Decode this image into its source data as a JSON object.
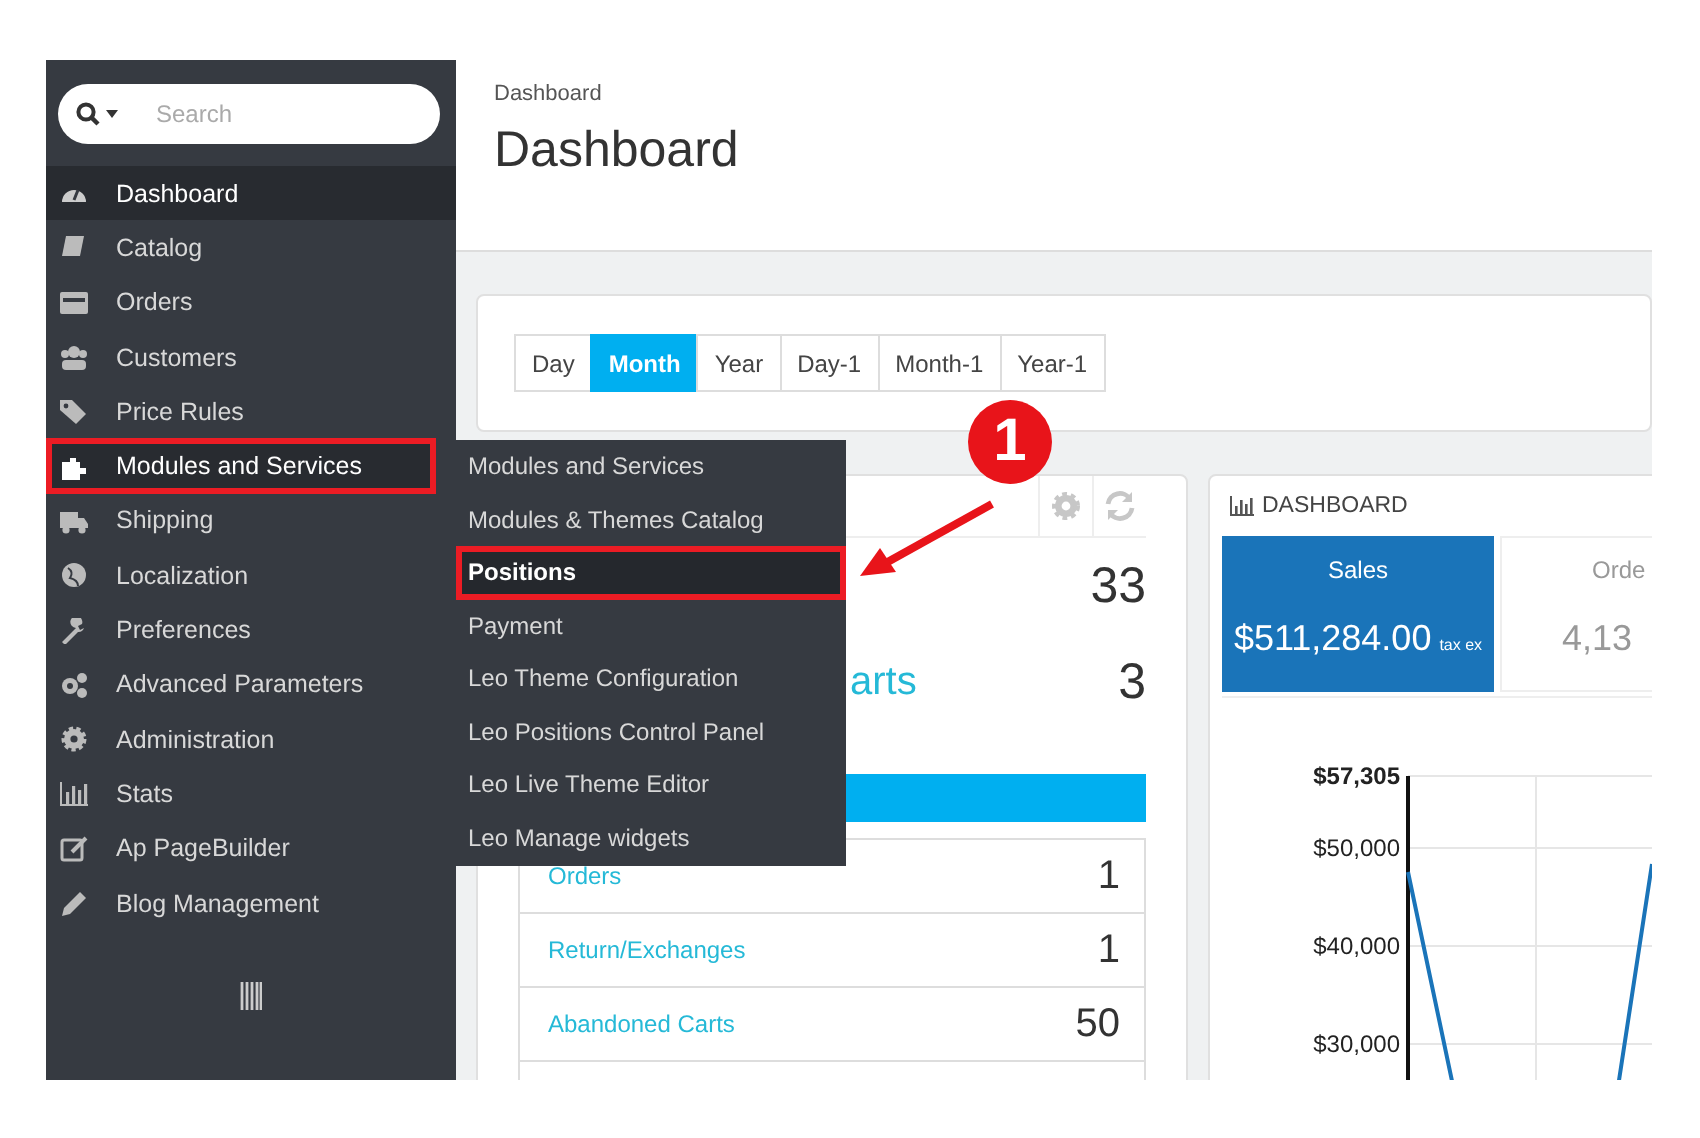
{
  "search": {
    "placeholder": "Search"
  },
  "sidebar": {
    "items": [
      {
        "label": "Dashboard",
        "selected": true,
        "annotated": false
      },
      {
        "label": "Catalog",
        "selected": false,
        "annotated": false
      },
      {
        "label": "Orders",
        "selected": false,
        "annotated": false
      },
      {
        "label": "Customers",
        "selected": false,
        "annotated": false
      },
      {
        "label": "Price Rules",
        "selected": false,
        "annotated": false
      },
      {
        "label": "Modules and Services",
        "selected": true,
        "annotated": true
      },
      {
        "label": "Shipping",
        "selected": false,
        "annotated": false
      },
      {
        "label": "Localization",
        "selected": false,
        "annotated": false
      },
      {
        "label": "Preferences",
        "selected": false,
        "annotated": false
      },
      {
        "label": "Advanced Parameters",
        "selected": false,
        "annotated": false
      },
      {
        "label": "Administration",
        "selected": false,
        "annotated": false
      },
      {
        "label": "Stats",
        "selected": false,
        "annotated": false
      },
      {
        "label": "Ap PageBuilder",
        "selected": false,
        "annotated": false
      },
      {
        "label": "Blog Management",
        "selected": false,
        "annotated": false
      }
    ]
  },
  "submenu": {
    "items": [
      {
        "label": "Modules and Services",
        "selected": false
      },
      {
        "label": "Modules & Themes Catalog",
        "selected": false
      },
      {
        "label": "Positions",
        "selected": true
      },
      {
        "label": "Payment",
        "selected": false
      },
      {
        "label": "Leo Theme Configuration",
        "selected": false
      },
      {
        "label": "Leo Positions Control Panel",
        "selected": false
      },
      {
        "label": "Leo Live Theme Editor",
        "selected": false
      },
      {
        "label": "Leo Manage widgets",
        "selected": false
      }
    ]
  },
  "callout": {
    "number": "1"
  },
  "header": {
    "breadcrumb": "Dashboard",
    "title": "Dashboard"
  },
  "period_buttons": [
    {
      "label": "Day",
      "selected": false
    },
    {
      "label": "Month",
      "selected": true
    },
    {
      "label": "Year",
      "selected": false
    },
    {
      "label": "Day-1",
      "selected": false
    },
    {
      "label": "Month-1",
      "selected": false
    },
    {
      "label": "Year-1",
      "selected": false
    }
  ],
  "activity_panel": {
    "summary": [
      {
        "value": "33"
      },
      {
        "label": "arts",
        "value": "3"
      }
    ],
    "list": [
      {
        "label": "Orders",
        "value": "1"
      },
      {
        "label": "Return/Exchanges",
        "value": "1"
      },
      {
        "label": "Abandoned Carts",
        "value": "50"
      }
    ]
  },
  "dashboard_panel": {
    "title": "DASHBOARD",
    "tiles": [
      {
        "label": "Sales",
        "value": "$511,284.00",
        "note": "tax ex",
        "selected": true
      },
      {
        "label": "Orde",
        "value": "4,13",
        "selected": false
      }
    ],
    "chart": {
      "kind": "picture",
      "y_labels": [
        "$57,305",
        "$50,000",
        "$40,000",
        "$30,000"
      ]
    }
  }
}
